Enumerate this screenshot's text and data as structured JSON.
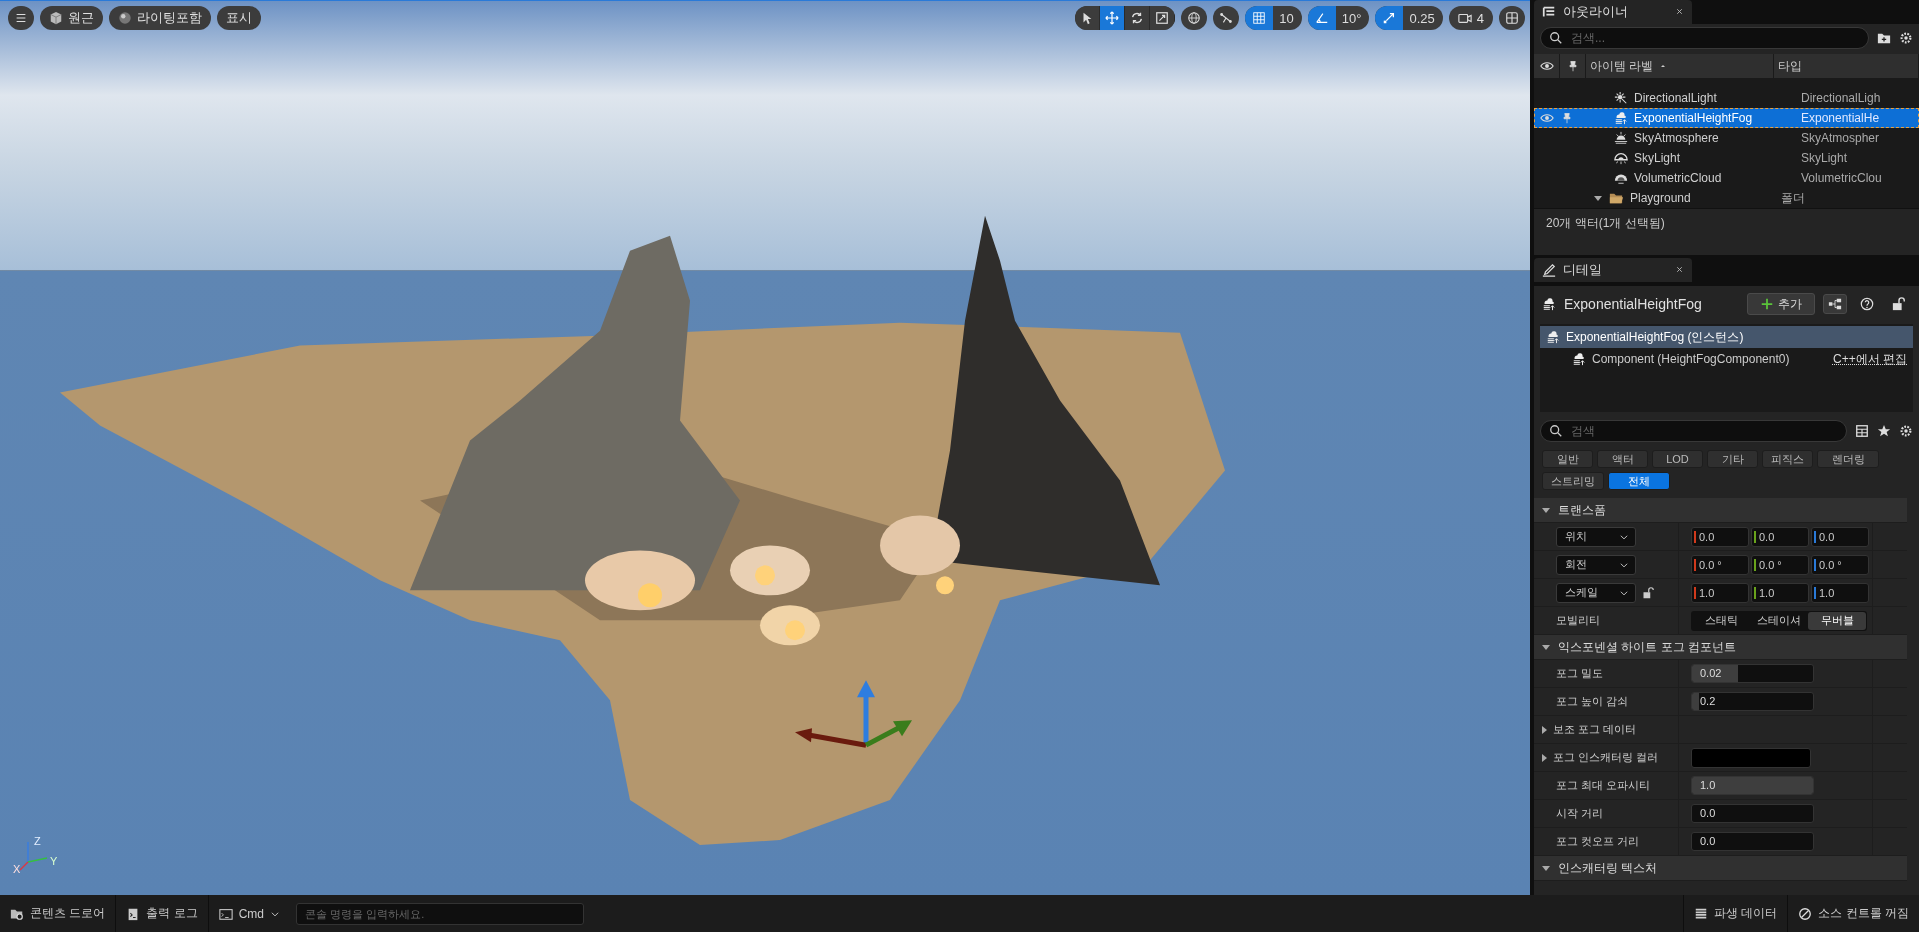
{
  "viewport": {
    "left_buttons": [
      {
        "kind": "menu"
      },
      {
        "kind": "cube",
        "label": "원근"
      },
      {
        "kind": "sphere",
        "label": "라이팅포함"
      },
      {
        "kind": "text",
        "label": "표시"
      }
    ],
    "transform_tools": [
      {
        "kind": "select",
        "selected": false
      },
      {
        "kind": "move",
        "selected": true
      },
      {
        "kind": "rotate",
        "selected": false
      },
      {
        "kind": "scale",
        "selected": false
      }
    ],
    "grid_snap": {
      "on": true,
      "value": "10"
    },
    "angle_snap": {
      "on": true,
      "value": "10°"
    },
    "scale_snap": {
      "on": true,
      "value": "0.25"
    },
    "camera_speed": "4",
    "axis_labels": {
      "z": "Z",
      "y": "Y",
      "x": "X"
    }
  },
  "outliner": {
    "tab": "아웃라이너",
    "search_placeholder": "검색...",
    "columns": [
      "아이템 라벨",
      "타입"
    ],
    "rows": [
      {
        "label": "DirectionalLight",
        "type": "DirectionalLigh",
        "kind": "light",
        "selected": false
      },
      {
        "label": "ExponentialHeightFog",
        "type": "ExponentialHe",
        "kind": "fog",
        "selected": true
      },
      {
        "label": "SkyAtmosphere",
        "type": "SkyAtmospher",
        "kind": "atmosphere",
        "selected": false
      },
      {
        "label": "SkyLight",
        "type": "SkyLight",
        "kind": "skylight",
        "selected": false
      },
      {
        "label": "VolumetricCloud",
        "type": "VolumetricClou",
        "kind": "cloud",
        "selected": false
      },
      {
        "label": "Playground",
        "type": "폴더",
        "kind": "folder",
        "selected": false
      }
    ],
    "status": "20개 액터(1개 선택됨)"
  },
  "details": {
    "tab": "디테일",
    "title": "ExponentialHeightFog",
    "add_button": "추가",
    "components": [
      {
        "label": "ExponentialHeightFog (인스턴스)",
        "selected": true
      },
      {
        "label": "Component (HeightFogComponent0)",
        "selected": false,
        "link": "C++에서 편집"
      }
    ],
    "search_placeholder": "검색",
    "filters": [
      {
        "label": "일반",
        "selected": false
      },
      {
        "label": "액터",
        "selected": false
      },
      {
        "label": "LOD",
        "selected": false
      },
      {
        "label": "기타",
        "selected": false
      },
      {
        "label": "피직스",
        "selected": false
      },
      {
        "label": "렌더링",
        "selected": false
      },
      {
        "label": "스트리밍",
        "selected": false
      },
      {
        "label": "전체",
        "selected": true
      }
    ],
    "sections": [
      {
        "title": "트랜스폼",
        "expanded": true,
        "rows": [
          {
            "kind": "vector",
            "label": "위치",
            "values": [
              "0.0",
              "0.0",
              "0.0"
            ],
            "lock": false
          },
          {
            "kind": "vector",
            "label": "회전",
            "values": [
              "0.0 °",
              "0.0 °",
              "0.0 °"
            ],
            "lock": false
          },
          {
            "kind": "vector",
            "label": "스케일",
            "values": [
              "1.0",
              "1.0",
              "1.0"
            ],
            "lock": true
          },
          {
            "kind": "segmented",
            "label": "모빌리티",
            "options": [
              {
                "label": "스태틱",
                "selected": false
              },
              {
                "label": "스테이셔",
                "selected": false
              },
              {
                "label": "무버블",
                "selected": true
              }
            ]
          }
        ]
      },
      {
        "title": "익스포넨셜 하이트 포그 컴포넌트",
        "expanded": true,
        "rows": [
          {
            "kind": "number",
            "label": "포그 밀도",
            "value": "0.02",
            "level": 0.38
          },
          {
            "kind": "number",
            "label": "포그 높이 감쇠",
            "value": "0.2",
            "level": 0.06
          },
          {
            "kind": "group",
            "label": "보조 포그 데이터"
          },
          {
            "kind": "color",
            "label": "포그 인스캐터링 컬러"
          },
          {
            "kind": "number",
            "label": "포그 최대 오파시티",
            "value": "1.0",
            "level": 1
          },
          {
            "kind": "number",
            "label": "시작 거리",
            "value": "0.0",
            "level": 0
          },
          {
            "kind": "number",
            "label": "포그 컷오프 거리",
            "value": "0.0",
            "level": 0
          }
        ]
      },
      {
        "title": "인스캐터링 텍스처",
        "expanded": true
      }
    ]
  },
  "bottom_bar": {
    "content_drawer": "콘텐츠 드로어",
    "output_log": "출력 로그",
    "cmd": "Cmd",
    "console_placeholder": "콘솔 명령을 입력하세요.",
    "derived_data": "파생 데이터",
    "source_control": "소스 컨트롤 꺼짐"
  }
}
